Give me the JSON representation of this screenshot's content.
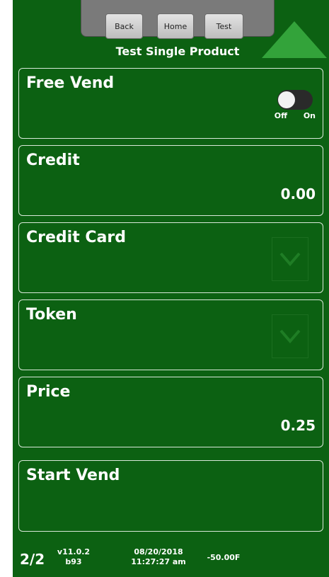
{
  "header": {
    "buttons": {
      "back": "Back",
      "home": "Home",
      "test": "Test"
    },
    "title": "Test Single Product"
  },
  "rows": {
    "free_vend": {
      "label": "Free Vend",
      "toggle_off": "Off",
      "toggle_on": "On"
    },
    "credit": {
      "label": "Credit",
      "value": "0.00"
    },
    "credit_card": {
      "label": "Credit Card",
      "checked": true
    },
    "token": {
      "label": "Token",
      "checked": true
    },
    "price": {
      "label": "Price",
      "value": "0.25"
    },
    "start_vend": {
      "label": "Start Vend"
    }
  },
  "footer": {
    "page": "2/2",
    "version": "v11.0.2",
    "build": "b93",
    "date": "08/20/2018",
    "time": "11:27:27 am",
    "temperature": "-50.00F"
  },
  "colors": {
    "background": "#0c6112",
    "card_border": "#d9e8d9",
    "arrow": "#33a33a",
    "check": "#1f7d25"
  }
}
